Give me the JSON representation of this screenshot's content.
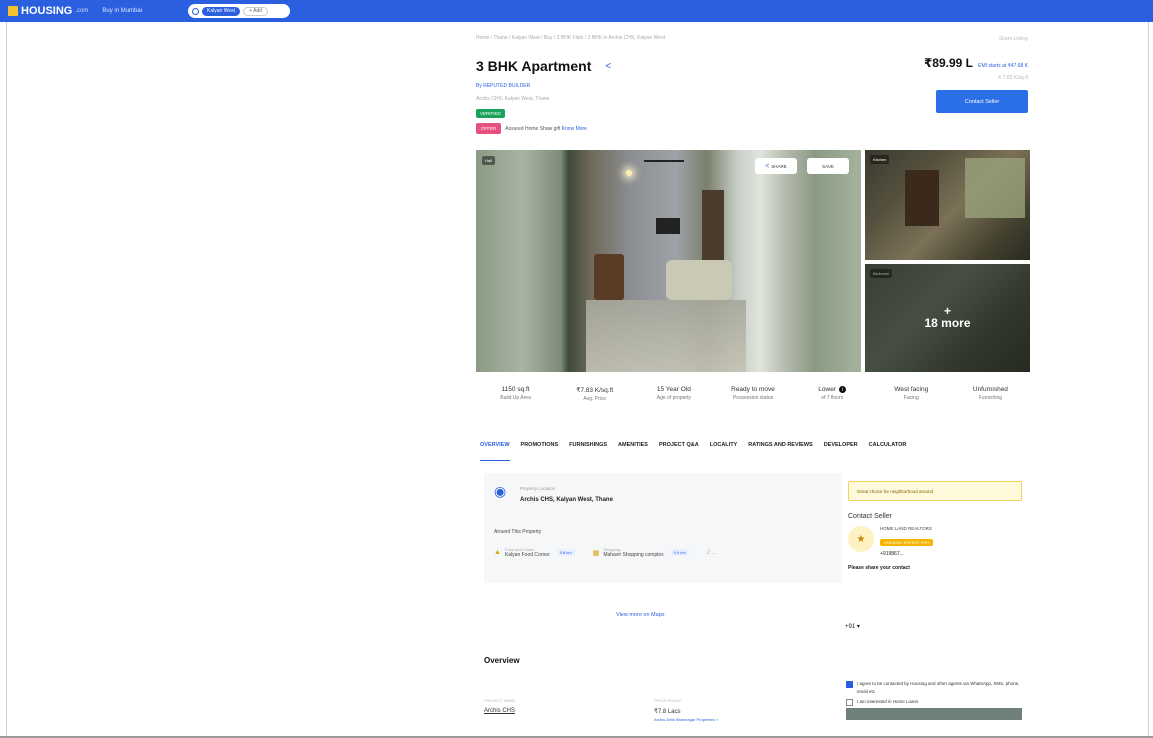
{
  "header": {
    "logo": "HOUSING",
    "logo_suffix": ".com",
    "city": "Buy in Mumbai",
    "search_chip": "Kalyan West",
    "add_chip": "+ Add"
  },
  "breadcrumb": "Home / Thane / Kalyan West / Buy / 3 BHK Flats / 3 BHK in Archis CHS, Kalyan West",
  "breadcrumb_right": "Share Listing",
  "property": {
    "title": "3 BHK Apartment",
    "builder": "By REPUTED BUILDER",
    "address": "Archis CHS, Kalyan West, Thane",
    "verified": "VERIFIED",
    "offer_tag": "OFFER",
    "offer_text": "Assured Home Shaw gift",
    "offer_link": "Know More"
  },
  "pricing": {
    "price": "₹89.99 L",
    "emi": "EMI starts at ₹47.68 K",
    "sub": "₹ 7.83 K/sq.ft",
    "contact_button": "Contact Seller"
  },
  "gallery": {
    "main_badge": "Hall",
    "share_label": "SHARE",
    "save_label": "SAVE",
    "side1_badge": "Kitchen",
    "side2_badge": "Bedroom",
    "more_plus": "+",
    "more_text": "18 more"
  },
  "specs": [
    {
      "value": "1150 sq.ft",
      "label": "Build Up Area"
    },
    {
      "value": "₹7.83 K/sq.ft",
      "label": "Avg. Price"
    },
    {
      "value": "15 Year Old",
      "label": "Age of property"
    },
    {
      "value": "Ready to move",
      "label": "Possession status"
    },
    {
      "value": "Lower",
      "label": "of 7 floors"
    },
    {
      "value": "West facing",
      "label": "Facing"
    },
    {
      "value": "Unfurnished",
      "label": "Furnishing"
    }
  ],
  "tabs": [
    "OVERVIEW",
    "PROMOTIONS",
    "FURNISHINGS",
    "AMENITIES",
    "PROJECT Q&A",
    "LOCALITY",
    "RATINGS AND REVIEWS",
    "DEVELOPER",
    "CALCULATOR"
  ],
  "locality": {
    "label": "Property Location",
    "value": "Archis CHS, Kalyan West, Thane",
    "around_title": "Around This Property",
    "places": [
      {
        "category": "Food and Drinks",
        "name": "Kalyan Food Corner",
        "distance": "0.8 km"
      },
      {
        "category": "Shopping",
        "name": "Mahavir Shopping complex",
        "distance": "0.9 km"
      }
    ],
    "more": "2 ...",
    "view_map": "View more on Maps"
  },
  "sidebar": {
    "highlight": "Great choice for neighborhood around",
    "contact_title": "Contact Seller",
    "seller_name": "HOME LAND REALTORS",
    "seller_badge": "HOUSING EXPERT PRO",
    "seller_phone": "+919867...",
    "share_contact": "Please share your contact",
    "country_code": "+91 ▾"
  },
  "overview": {
    "title": "Overview",
    "project_label": "PROJECT NAME",
    "project_value": "Archis CHS",
    "price_label": "PRICE RANGE",
    "price_value": "₹7.8 Lacs",
    "price_sub": "Archis 2bhk Bhavnagar Properties >"
  },
  "consent": {
    "agree": "I agree to be contacted by Housing and other agents via WhatsApp, SMS, phone, email etc",
    "loan": "I am interested in Home Loans"
  }
}
